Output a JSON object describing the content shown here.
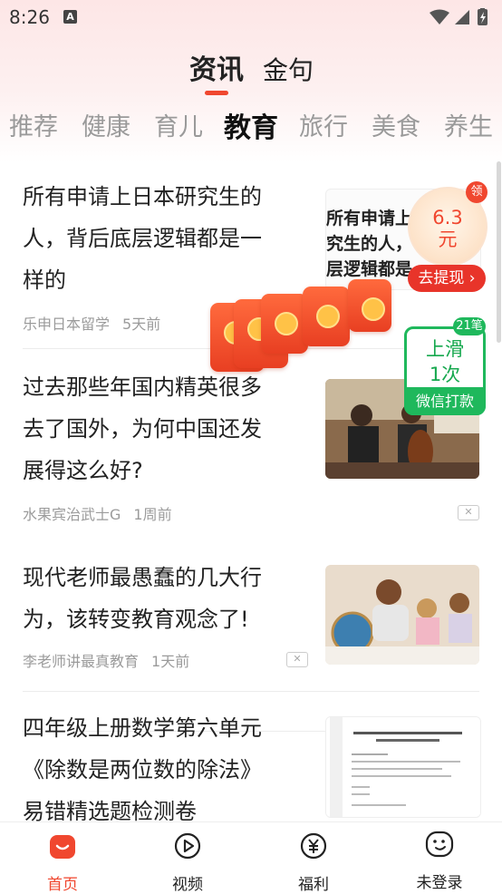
{
  "status_bar": {
    "time": "8:26",
    "notification_icon": "A"
  },
  "main_tabs": [
    {
      "label": "资讯",
      "active": true
    },
    {
      "label": "金句",
      "active": false
    }
  ],
  "categories": [
    {
      "label": "推荐",
      "active": false
    },
    {
      "label": "健康",
      "active": false
    },
    {
      "label": "育儿",
      "active": false
    },
    {
      "label": "教育",
      "active": true
    },
    {
      "label": "旅行",
      "active": false
    },
    {
      "label": "美食",
      "active": false
    },
    {
      "label": "养生",
      "active": false
    }
  ],
  "articles": [
    {
      "title_lines": [
        "所有申请上日本研究生的",
        "人，背后底层逻辑都是一",
        "样的"
      ],
      "source": "乐申日本留学",
      "time": "5天前",
      "thumb_text": [
        "所有申请上",
        "究生的人，",
        "层逻辑都是"
      ]
    },
    {
      "title_lines": [
        "过去那些年国内精英很多",
        "去了国外，为何中国还发",
        "展得这么好?"
      ],
      "source": "水果宾治武士G",
      "time": "1周前"
    },
    {
      "title_lines": [
        "现代老师最愚蠢的几大行",
        "为，该转变教育观念了!"
      ],
      "source": "李老师讲最真教育",
      "time": "1天前"
    },
    {
      "title_lines": [
        "四年级上册数学第六单元",
        "《除数是两位数的除法》",
        "易错精选题检测卷"
      ]
    }
  ],
  "coin_widget": {
    "amount": "6.3",
    "unit": "元",
    "badge": "领",
    "button": "去提现"
  },
  "swipe_widget": {
    "line1": "上滑",
    "line2": "1次",
    "label": "微信打款",
    "badge": "21笔"
  },
  "bottom_nav": [
    {
      "label": "首页",
      "icon": "home-icon",
      "active": true
    },
    {
      "label": "视频",
      "icon": "play-icon",
      "active": false
    },
    {
      "label": "福利",
      "icon": "yuan-icon",
      "active": false
    },
    {
      "label": "未登录",
      "icon": "user-face-icon",
      "active": false
    }
  ],
  "colors": {
    "accent": "#f0472f",
    "green": "#1fb85c",
    "bg_top": "#fde6e6"
  }
}
